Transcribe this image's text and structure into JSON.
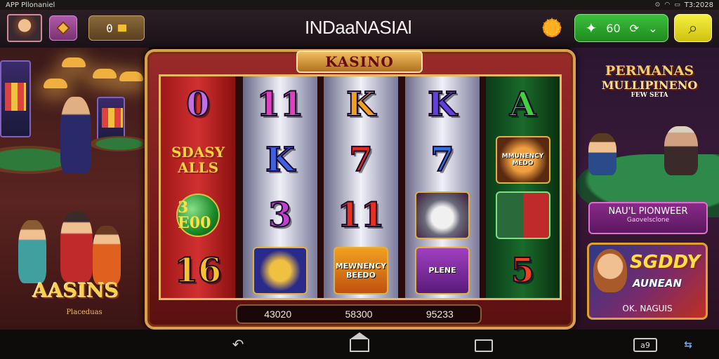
{
  "status_bar": {
    "left_text": "APP Pllonaniel",
    "time": "T3:2028"
  },
  "header": {
    "title": "INDaaNASIAl",
    "wallet_value": "0",
    "balance": "60",
    "icons": {
      "avatar": "player-avatar",
      "diamond": "gem-icon",
      "wallet": "coin-icon",
      "sun": "sun-icon",
      "star": "star-icon",
      "refresh": "refresh-icon",
      "search": "search-icon"
    }
  },
  "left_panel": {
    "logo": "AASINS",
    "logo_sub": "Placeduas"
  },
  "right_panel": {
    "promo_line1": "PERMANAS",
    "promo_line2": "MULLIPINENO",
    "promo_line3": "FEW SETA",
    "info_title": "NAU'L PIONWEER",
    "info_sub": "Gaovelsclone",
    "feature_title": "SGDDY",
    "feature_sub": "AUNEAN",
    "feature_footer": "OK. NAGUIS"
  },
  "slot": {
    "header": "KASINO",
    "reels": [
      [
        "0",
        "SDASY ALLS",
        "3 E00",
        "16"
      ],
      [
        "11",
        "K",
        "3",
        "badge"
      ],
      [
        "K",
        "7",
        "11",
        "MEWNENCY BEEDO"
      ],
      [
        "K",
        "7",
        "husky",
        "PLENE"
      ],
      [
        "A",
        "MMUNENCY MEDO",
        "couple",
        "5"
      ]
    ],
    "bets": [
      "43020",
      "58300",
      "95233"
    ]
  },
  "nav": {
    "extra_label": "a9"
  },
  "colors": {
    "accent_green": "#2aa82a",
    "accent_yellow": "#e8e020",
    "frame_gold": "#d8a050",
    "cabinet_red": "#8a1a1a"
  }
}
